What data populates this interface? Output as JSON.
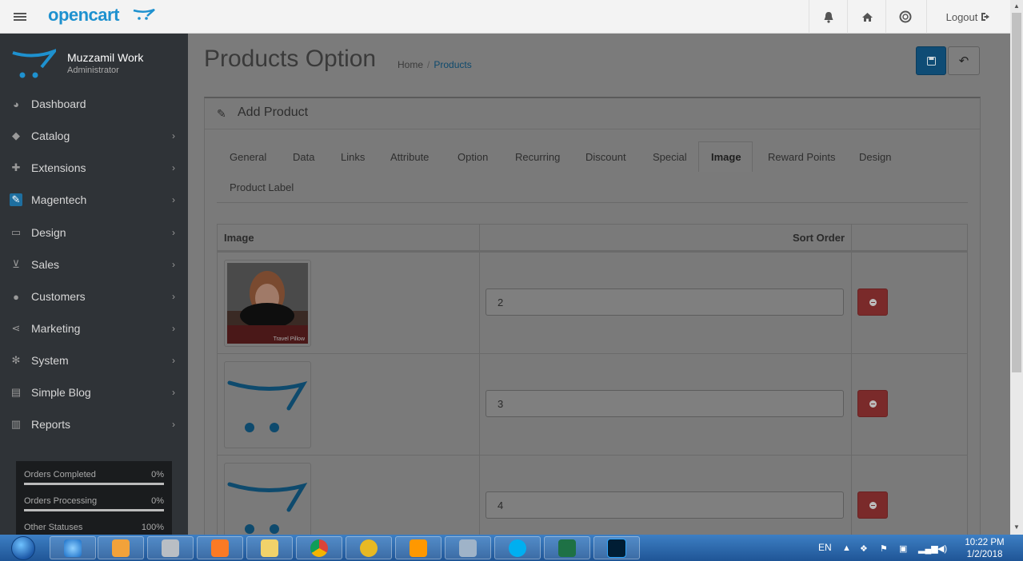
{
  "header": {
    "logo": "opencart",
    "logout_label": "Logout",
    "icons": [
      "bell-icon",
      "home-icon",
      "life-ring-icon",
      "sign-out-icon"
    ]
  },
  "sidebar": {
    "profile": {
      "name": "Muzzamil Work",
      "role": "Administrator"
    },
    "items": [
      {
        "label": "Dashboard",
        "icon": "dashboard-icon",
        "has_children": false
      },
      {
        "label": "Catalog",
        "icon": "tags-icon",
        "has_children": true
      },
      {
        "label": "Extensions",
        "icon": "puzzle-icon",
        "has_children": true
      },
      {
        "label": "Magentech",
        "icon": "wrench-icon",
        "has_children": true
      },
      {
        "label": "Design",
        "icon": "television-icon",
        "has_children": true
      },
      {
        "label": "Sales",
        "icon": "shopping-cart-icon",
        "has_children": true
      },
      {
        "label": "Customers",
        "icon": "user-icon",
        "has_children": true
      },
      {
        "label": "Marketing",
        "icon": "share-icon",
        "has_children": true
      },
      {
        "label": "System",
        "icon": "cog-icon",
        "has_children": true
      },
      {
        "label": "Simple Blog",
        "icon": "file-icon",
        "has_children": true
      },
      {
        "label": "Reports",
        "icon": "bar-chart-icon",
        "has_children": true
      }
    ],
    "stats": [
      {
        "label": "Orders Completed",
        "value": "0%"
      },
      {
        "label": "Orders Processing",
        "value": "0%"
      },
      {
        "label": "Other Statuses",
        "value": "100%"
      }
    ]
  },
  "page": {
    "title": "Products Option",
    "breadcrumb": [
      "Home",
      "Products"
    ]
  },
  "panel": {
    "title": "Add Product",
    "tabs": [
      "General",
      "Data",
      "Links",
      "Attribute",
      "Option",
      "Recurring",
      "Discount",
      "Special",
      "Image",
      "Reward Points",
      "Design",
      "Product Label"
    ],
    "active_tab": "Image"
  },
  "image_table": {
    "headers": {
      "image": "Image",
      "sort_order": "Sort Order"
    },
    "rows": [
      {
        "image": "photo",
        "sort_order": "2",
        "caption": "Travel Pillow"
      },
      {
        "image": "placeholder",
        "sort_order": "3"
      },
      {
        "image": "placeholder",
        "sort_order": "4"
      }
    ]
  },
  "taskbar": {
    "language": "EN",
    "time": "10:22 PM",
    "date": "1/2/2018"
  },
  "colors": {
    "accent": "#1e91cf",
    "sidebar": "#2f3337",
    "danger": "#f56b6b"
  }
}
